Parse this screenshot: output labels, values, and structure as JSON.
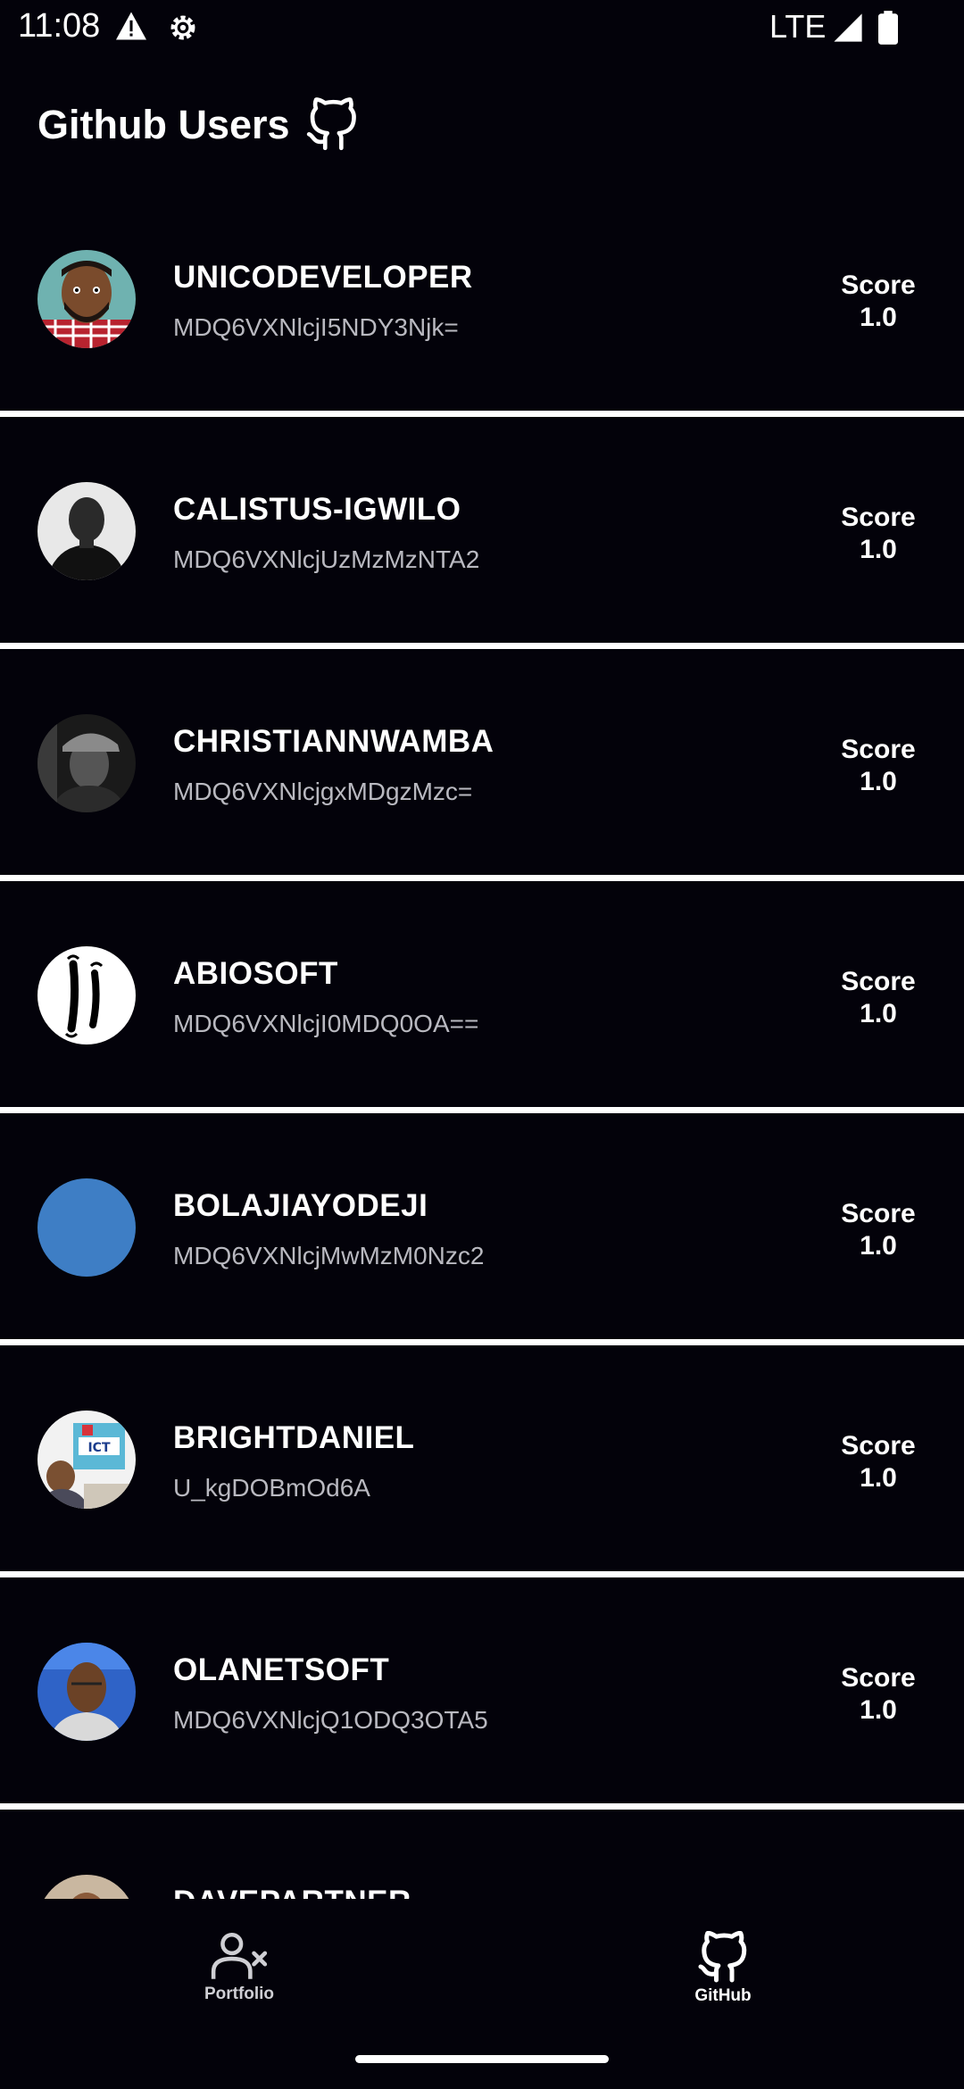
{
  "status_bar": {
    "time": "11:08",
    "network": "LTE",
    "icons": [
      "warning-icon",
      "settings-icon",
      "signal-icon",
      "battery-icon"
    ]
  },
  "header": {
    "title": "Github Users",
    "icon": "github-icon"
  },
  "score_label": "Score",
  "users": [
    {
      "login": "UNICODEVELOPER",
      "node_id": "MDQ6VXNlcjI5NDY3Njk=",
      "score": "1.0",
      "avatar": "avatar-cartoon-bearded"
    },
    {
      "login": "CALISTUS-IGWILO",
      "node_id": "MDQ6VXNlcjUzMzMzNTA2",
      "score": "1.0",
      "avatar": "avatar-photo-grayscale"
    },
    {
      "login": "CHRISTIANNWAMBA",
      "node_id": "MDQ6VXNlcjgxMDgzMzc=",
      "score": "1.0",
      "avatar": "avatar-photo-cap"
    },
    {
      "login": "ABIOSOFT",
      "node_id": "MDQ6VXNlcjI0MDQ0OA==",
      "score": "1.0",
      "avatar": "avatar-calligraphy-logo"
    },
    {
      "login": "BOLAJIAYODEJI",
      "node_id": "MDQ6VXNlcjMwMzM0Nzc2",
      "score": "1.0",
      "avatar": "avatar-blue-circle"
    },
    {
      "login": "BRIGHTDANIEL",
      "node_id": "U_kgDOBmOd6A",
      "score": "1.0",
      "avatar": "avatar-ict-photo"
    },
    {
      "login": "OLANETSOFT",
      "node_id": "MDQ6VXNlcjQ1ODQ3OTA5",
      "score": "1.0",
      "avatar": "avatar-photo-blue"
    },
    {
      "login": "DAVEPARTNER",
      "node_id": "",
      "score": "",
      "avatar": "avatar-photo-partial"
    }
  ],
  "bottom_nav": {
    "items": [
      {
        "label": "Portfolio",
        "icon": "person-remove-icon",
        "active": false
      },
      {
        "label": "GitHub",
        "icon": "github-icon",
        "active": true
      }
    ]
  },
  "colors": {
    "background": "#03020a",
    "divider": "#ffffff",
    "text_primary": "#ffffff",
    "text_secondary": "#b9b9c0",
    "avatar_blue": "#3e7ec5"
  }
}
